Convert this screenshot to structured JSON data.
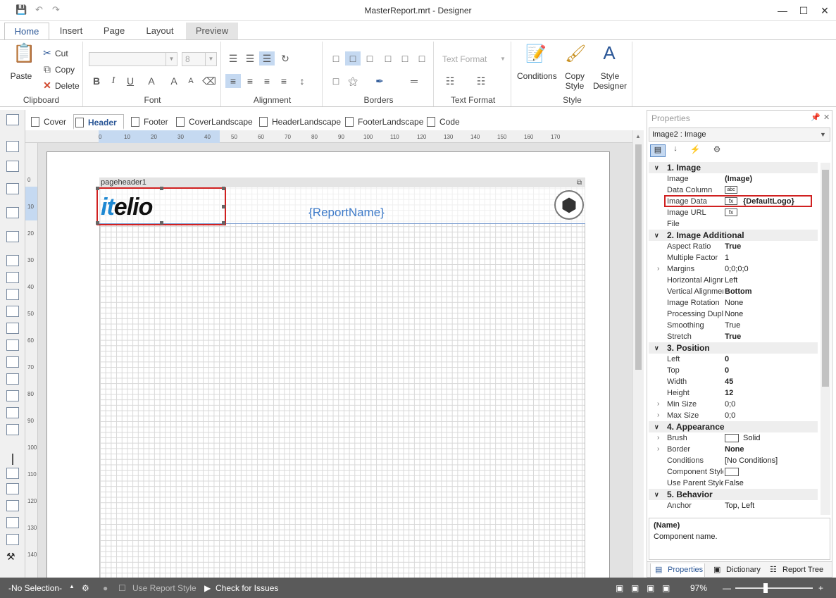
{
  "window": {
    "title": "MasterReport.mrt - Designer"
  },
  "ribbon_tabs": [
    "Home",
    "Insert",
    "Page",
    "Layout",
    "Preview"
  ],
  "clipboard": {
    "paste": "Paste",
    "cut": "Cut",
    "copy": "Copy",
    "delete": "Delete",
    "label": "Clipboard"
  },
  "font": {
    "size": "8",
    "label": "Font"
  },
  "alignment": {
    "label": "Alignment"
  },
  "borders": {
    "label": "Borders"
  },
  "text_format": {
    "combo": "Text Format",
    "label": "Text Format"
  },
  "style": {
    "conditions": "Conditions",
    "copy_style_1": "Copy",
    "copy_style_2": "Style",
    "style_designer_1": "Style",
    "style_designer_2": "Designer",
    "label": "Style"
  },
  "doc_tabs": [
    "Cover",
    "Header",
    "Footer",
    "CoverLandscape",
    "HeaderLandscape",
    "FooterLandscape",
    "Code"
  ],
  "ruler_h": [
    "0",
    "10",
    "20",
    "30",
    "40",
    "50",
    "60",
    "70",
    "80",
    "90",
    "100",
    "110",
    "120",
    "130",
    "140",
    "150",
    "160",
    "170"
  ],
  "ruler_v": [
    "0",
    "10",
    "20",
    "30",
    "40",
    "50",
    "60",
    "70",
    "80",
    "90",
    "100",
    "110",
    "120",
    "130",
    "140"
  ],
  "design": {
    "band_name": "pageheader1",
    "logo_it": "it",
    "logo_elio": "elio",
    "report_name": "{ReportName}"
  },
  "properties": {
    "title": "Properties",
    "selected": "Image2 : Image",
    "categories": [
      {
        "name": "1. Image",
        "rows": [
          {
            "n": "Image",
            "v": "(Image)",
            "bold": true
          },
          {
            "n": "Data Column",
            "v": ""
          },
          {
            "n": "Image Data",
            "v": "{DefaultLogo}",
            "bold": true
          },
          {
            "n": "Image URL",
            "v": ""
          },
          {
            "n": "File",
            "v": ""
          }
        ]
      },
      {
        "name": "2. Image  Additional",
        "rows": [
          {
            "n": "Aspect Ratio",
            "v": "True",
            "bold": true
          },
          {
            "n": "Multiple Factor",
            "v": "1"
          },
          {
            "n": "Margins",
            "v": "0;0;0;0",
            "exp": true
          },
          {
            "n": "Horizontal Alignm",
            "v": "Left"
          },
          {
            "n": "Vertical Alignmer",
            "v": "Bottom",
            "bold": true
          },
          {
            "n": "Image Rotation",
            "v": "None"
          },
          {
            "n": "Processing Dupl",
            "v": "None"
          },
          {
            "n": "Smoothing",
            "v": "True"
          },
          {
            "n": "Stretch",
            "v": "True",
            "bold": true
          }
        ]
      },
      {
        "name": "3. Position",
        "rows": [
          {
            "n": "Left",
            "v": "0",
            "bold": true
          },
          {
            "n": "Top",
            "v": "0",
            "bold": true
          },
          {
            "n": "Width",
            "v": "45",
            "bold": true
          },
          {
            "n": "Height",
            "v": "12",
            "bold": true
          },
          {
            "n": "Min Size",
            "v": "0;0",
            "exp": true
          },
          {
            "n": "Max Size",
            "v": "0;0",
            "exp": true
          }
        ]
      },
      {
        "name": "4. Appearance",
        "rows": [
          {
            "n": "Brush",
            "v": "Solid",
            "exp": true
          },
          {
            "n": "Border",
            "v": "None",
            "bold": true,
            "exp": true
          },
          {
            "n": "Conditions",
            "v": "[No Conditions]"
          },
          {
            "n": "Component Style",
            "v": ""
          },
          {
            "n": "Use Parent Styles",
            "v": "False"
          }
        ]
      },
      {
        "name": "5. Behavior",
        "rows": [
          {
            "n": "Anchor",
            "v": "Top, Left"
          }
        ]
      }
    ],
    "desc_title": "(Name)",
    "desc_text": "Component name.",
    "bottom_tabs": [
      "Properties",
      "Dictionary",
      "Report Tree"
    ]
  },
  "status": {
    "selection": "-No Selection-",
    "use_report_style": "Use Report Style",
    "check": "Check for Issues",
    "zoom": "97%"
  }
}
